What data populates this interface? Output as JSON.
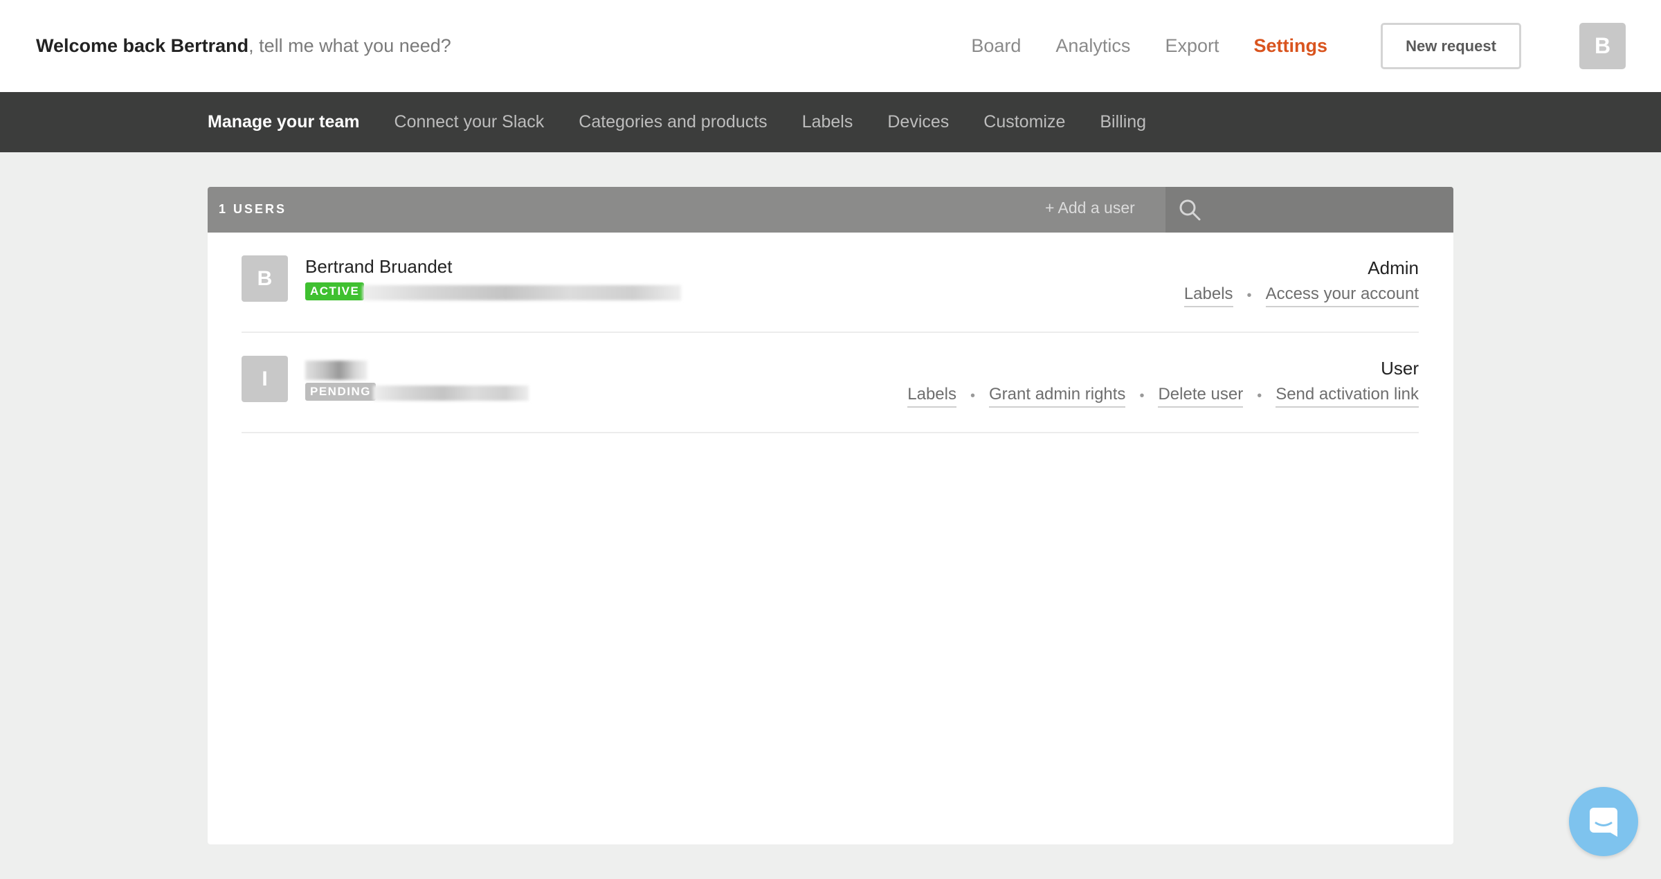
{
  "header": {
    "welcome_strong": "Welcome back Bertrand",
    "welcome_rest": ", tell me what you need?",
    "nav": [
      {
        "label": "Board"
      },
      {
        "label": "Analytics"
      },
      {
        "label": "Export"
      },
      {
        "label": "Settings",
        "active": true
      }
    ],
    "new_request_label": "New request",
    "avatar_initial": "B"
  },
  "subnav": {
    "items": [
      {
        "label": "Manage your team",
        "active": true
      },
      {
        "label": "Connect your Slack"
      },
      {
        "label": "Categories and products"
      },
      {
        "label": "Labels"
      },
      {
        "label": "Devices"
      },
      {
        "label": "Customize"
      },
      {
        "label": "Billing"
      }
    ]
  },
  "team": {
    "users_count_label": "1 USERS",
    "add_user_label": "+ Add a user",
    "search_placeholder": "",
    "users": [
      {
        "initial": "B",
        "name": "Bertrand Bruandet",
        "status": "ACTIVE",
        "role": "Admin",
        "actions": [
          "Labels",
          "Access your account"
        ]
      },
      {
        "initial": "I",
        "name": "",
        "status": "PENDING",
        "role": "User",
        "actions": [
          "Labels",
          "Grant admin rights",
          "Delete user",
          "Send activation link"
        ]
      }
    ]
  },
  "colors": {
    "accent": "#d9541e",
    "subnav_bg": "#3c3d3c",
    "panel_head_bg": "#8b8b8a",
    "active_badge": "#3fc030",
    "pending_badge": "#bdbdbd",
    "chat_bubble": "#7ec3ee"
  },
  "icons": {
    "search": "search-icon",
    "chat": "chat-icon"
  }
}
